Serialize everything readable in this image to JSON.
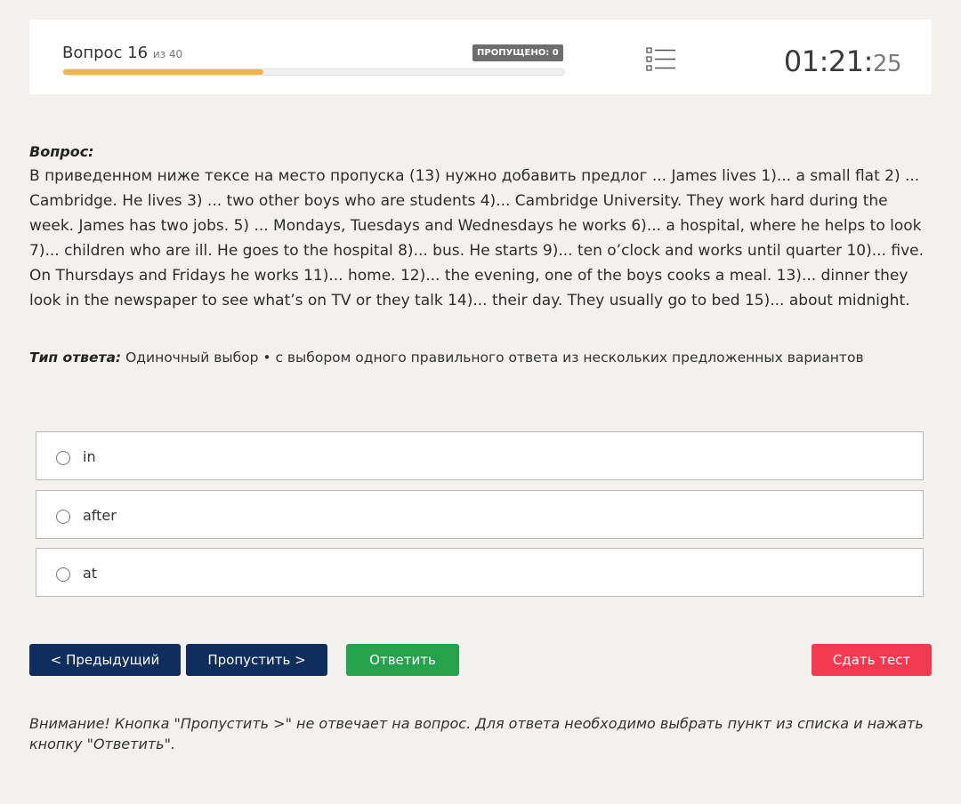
{
  "header": {
    "question_prefix": "Вопрос 16",
    "question_total": "из 40",
    "skipped_badge": "ПРОПУЩЕНО: 0",
    "progress_fraction": 0.4,
    "timer_hm": "01:21",
    "timer_colon": ":",
    "timer_sec": "25",
    "list_icon": "list-icon"
  },
  "question": {
    "label": "Вопрос:",
    "text": "В приведенном ниже тексе на место пропуска (13) нужно добавить предлог ... James lives 1)... a small flat 2) ... Cambridge. He lives 3) ... two other boys who are students 4)... Cambridge University. They work hard during the week. James has two jobs. 5) ... Mondays, Tuesdays and Wednesdays he works 6)... a hospital, where he helps to look 7)... children who are ill. He goes to the hospital 8)... bus. He starts 9)... ten o’clock and works until quarter 10)... five. On Thursdays and Fridays he works 11)... home. 12)... the evening, one of the boys cooks a meal. 13)... dinner they look in the newspaper to see what’s on TV or they talk 14)... their day. They usually go to bed 15)... about midnight."
  },
  "answer_type": {
    "label": "Тип ответа:",
    "value": "Одиночный выбор • с выбором одного правильного ответа из нескольких предложенных вариантов"
  },
  "options": [
    {
      "label": "in"
    },
    {
      "label": "after"
    },
    {
      "label": "at"
    }
  ],
  "buttons": {
    "prev": "< Предыдущий",
    "skip": "Пропустить >",
    "answer": "Ответить",
    "submit": "Сдать тест"
  },
  "notice": "Внимание! Кнопка \"Пропустить >\" не отвечает на вопрос. Для ответа необходимо выбрать пункт из списка и нажать кнопку \"Ответить\".",
  "colors": {
    "progress": "#efb44a",
    "nav_button": "#0f2e5e",
    "answer_button": "#26a24d",
    "submit_button": "#f13a4f"
  }
}
